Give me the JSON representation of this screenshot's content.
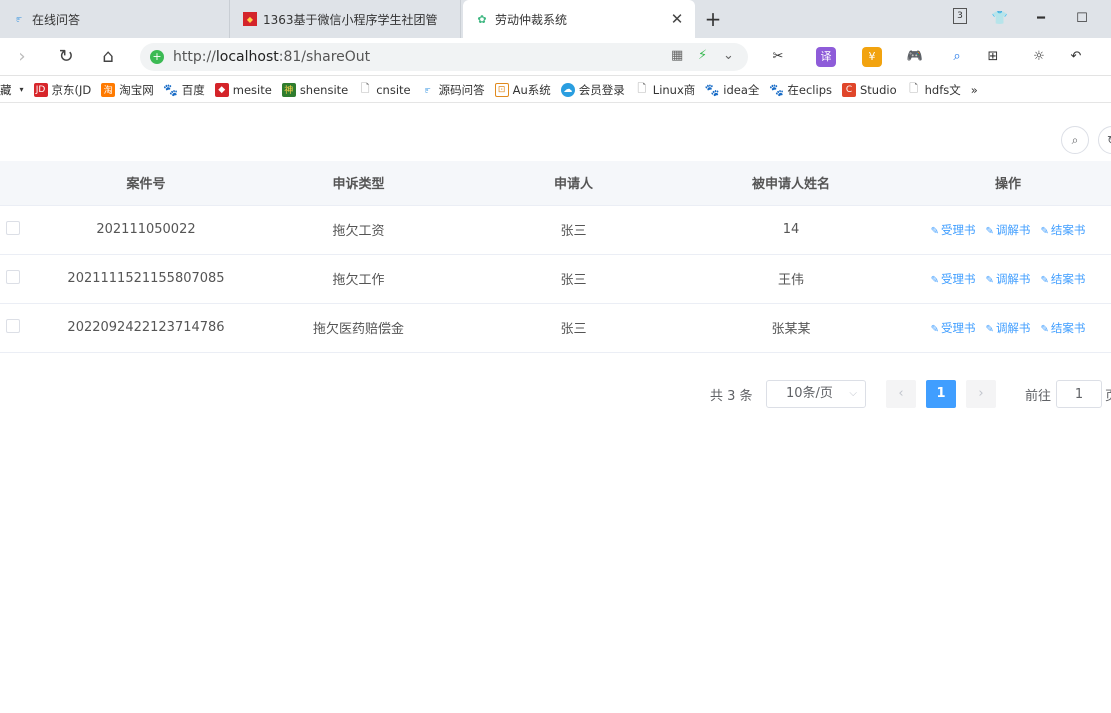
{
  "browser": {
    "tabs": [
      {
        "label": "在线问答"
      },
      {
        "label": "1363基于微信小程序学生社团管"
      },
      {
        "label": "劳动仲裁系统"
      }
    ],
    "tab_count": "3",
    "url": {
      "prefix": "http://",
      "host": "localhost",
      "rest": ":81/shareOut"
    },
    "bookmarks": [
      {
        "label": "藏"
      },
      {
        "label": "京东(JD"
      },
      {
        "label": "淘宝网"
      },
      {
        "label": "百度"
      },
      {
        "label": "mesite"
      },
      {
        "label": "shensite"
      },
      {
        "label": "cnsite"
      },
      {
        "label": "源码问答"
      },
      {
        "label": "Au系统"
      },
      {
        "label": "会员登录"
      },
      {
        "label": "Linux商"
      },
      {
        "label": "idea全"
      },
      {
        "label": "在eclips"
      },
      {
        "label": "Studio"
      },
      {
        "label": "hdfs文"
      },
      {
        "label": "»"
      }
    ]
  },
  "table": {
    "columns": [
      "案件号",
      "申诉类型",
      "申请人",
      "被申请人姓名",
      "操作"
    ],
    "rows": [
      {
        "case_no": "202111050022",
        "type": "拖欠工资",
        "applicant": "张三",
        "respondent": "14"
      },
      {
        "case_no": "2021111521155807085",
        "type": "拖欠工作",
        "applicant": "张三",
        "respondent": "王伟"
      },
      {
        "case_no": "2022092422123714786",
        "type": "拖欠医药赔偿金",
        "applicant": "张三",
        "respondent": "张某某"
      }
    ],
    "actions": [
      "受理书",
      "调解书",
      "结案书"
    ]
  },
  "pagination": {
    "total": "共 3 条",
    "page_size": "10条/页",
    "current_page": "1",
    "goto_label": "前往",
    "goto_value": "1",
    "goto_unit": "页"
  },
  "colors": {
    "accent": "#409eff",
    "header_bg": "#f5f7fa"
  }
}
